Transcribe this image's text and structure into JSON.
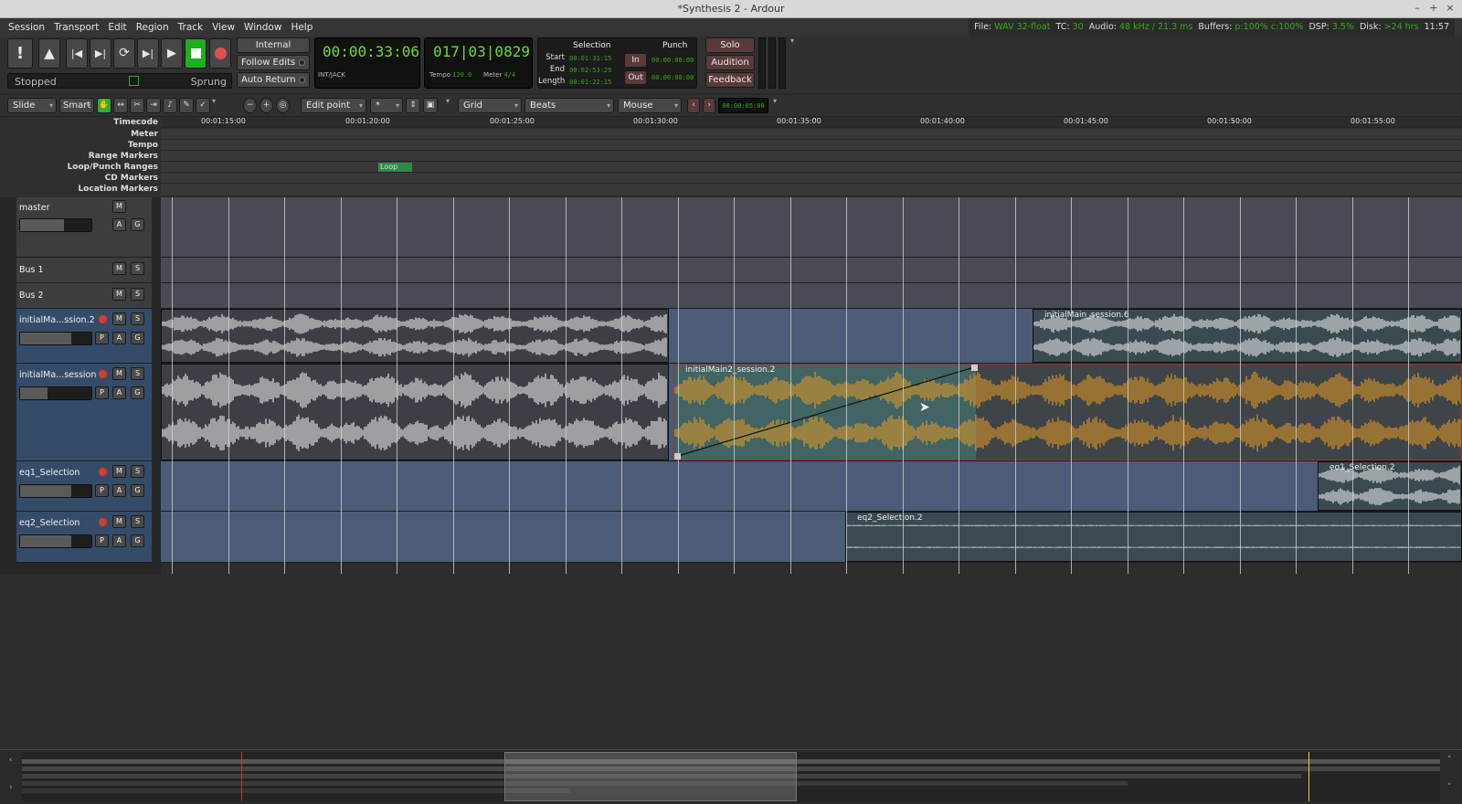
{
  "window": {
    "title": "*Synthesis 2 - Ardour"
  },
  "menu": [
    "Session",
    "Transport",
    "Edit",
    "Region",
    "Track",
    "View",
    "Window",
    "Help"
  ],
  "status": {
    "file_label": "File:",
    "file_value": "WAV 32-float",
    "tc_label": "TC:",
    "tc_value": "30",
    "audio_label": "Audio:",
    "audio_value": "48 kHz / 21.3 ms",
    "buffers_label": "Buffers:",
    "buffers_value": "p:100% c:100%",
    "dsp_label": "DSP:",
    "dsp_value": "3.5%",
    "disk_label": "Disk:",
    "disk_value": ">24 hrs",
    "time": "11:57"
  },
  "transport": {
    "state": "Stopped",
    "sprung": "Sprung",
    "internal": "Internal",
    "follow_edits": "Follow Edits",
    "auto_return": "Auto Return",
    "timecode": "00:00:33:06",
    "sync": "INT/JACK",
    "bbt": "017|03|0829",
    "tempo_label": "Tempo",
    "tempo_value": "120.0",
    "meter_label": "Meter",
    "meter_value": "4/4"
  },
  "selection": {
    "title": "Selection",
    "start_label": "Start",
    "start": "00:01:31:15",
    "end_label": "End",
    "end": "00:02:53:29",
    "length_label": "Length",
    "length": "00:01:22:15"
  },
  "punch": {
    "title": "Punch",
    "in": "In",
    "in_time": "00:00:00:00",
    "out": "Out",
    "out_time": "00:00:00:00"
  },
  "monitor": {
    "solo": "Solo",
    "audition": "Audition",
    "feedback": "Feedback"
  },
  "edit_toolbar": {
    "edit_mode": "Slide",
    "smart": "Smart",
    "edit_point": "Edit point",
    "nudge": "*",
    "grid_type": "Grid",
    "grid_unit": "Beats",
    "zoom_focus": "Mouse",
    "nudge_clock": "00:00:05:00"
  },
  "rulers": {
    "labels": [
      "Timecode",
      "Meter",
      "Tempo",
      "Range Markers",
      "Loop/Punch Ranges",
      "CD Markers",
      "Location Markers"
    ],
    "timecode_ticks": [
      "00:01:15:00",
      "00:01:20:00",
      "00:01:25:00",
      "00:01:30:00",
      "00:01:35:00",
      "00:01:40:00",
      "00:01:45:00",
      "00:01:50:00",
      "00:01:55:00"
    ],
    "loop_marker": "Loop"
  },
  "tracks": [
    {
      "name": "master",
      "buttons": [
        "M",
        "A",
        "G"
      ]
    },
    {
      "name": "Bus 1",
      "buttons": [
        "M",
        "S"
      ]
    },
    {
      "name": "Bus 2",
      "buttons": [
        "M",
        "S"
      ]
    },
    {
      "name": "initialMa...ssion.2",
      "buttons": [
        "M",
        "S",
        "P",
        "A",
        "G"
      ]
    },
    {
      "name": "initialMa...session",
      "buttons": [
        "M",
        "S",
        "P",
        "A",
        "G"
      ]
    },
    {
      "name": "eq1_Selection",
      "buttons": [
        "M",
        "S",
        "P",
        "A",
        "G"
      ]
    },
    {
      "name": "eq2_Selection",
      "buttons": [
        "M",
        "S",
        "P",
        "A",
        "G"
      ]
    }
  ],
  "regions": {
    "r1": "initialMain_session.6",
    "r2": "initialMain2_session.2",
    "r3": "eq1_Selection.2",
    "r4": "eq2_Selection.2"
  },
  "colors": {
    "lcd_green": "#6ddb2b",
    "region_orange": "#f0a020",
    "track_blue": "#4c5b78",
    "record_red": "#c84040"
  }
}
